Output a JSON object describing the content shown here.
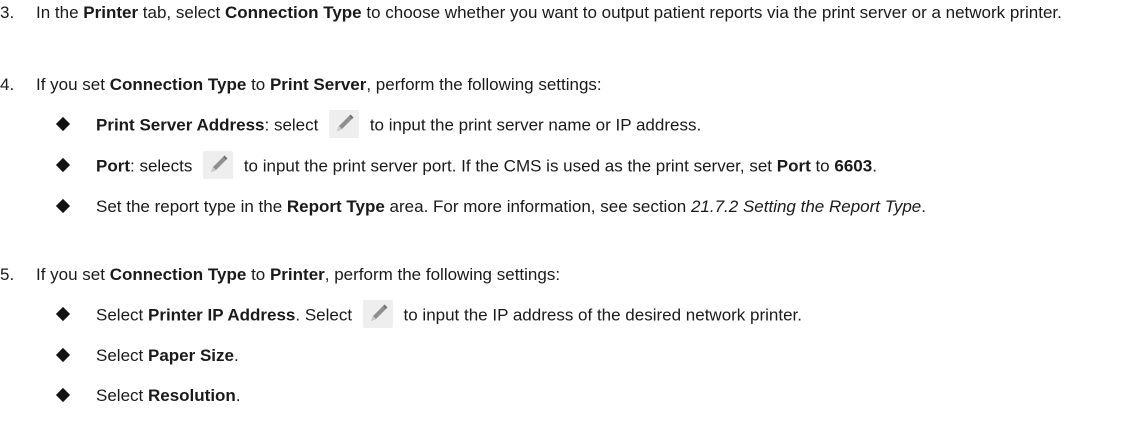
{
  "steps": [
    {
      "num": "3.",
      "parts": [
        {
          "t": "In the "
        },
        {
          "t": "Printer",
          "b": true
        },
        {
          "t": " tab, select "
        },
        {
          "t": "Connection Type",
          "b": true
        },
        {
          "t": " to choose whether you want to output patient reports via the print server or a network printer."
        }
      ]
    },
    {
      "num": "4.",
      "parts": [
        {
          "t": "If you set "
        },
        {
          "t": "Connection Type",
          "b": true
        },
        {
          "t": " to "
        },
        {
          "t": "Print Server",
          "b": true
        },
        {
          "t": ", perform the following settings:"
        }
      ],
      "bullets": [
        [
          {
            "t": "Print Server Address",
            "b": true
          },
          {
            "t": ": select "
          },
          {
            "icon": "pencil-edit-icon"
          },
          {
            "t": " to input the print server name or IP address."
          }
        ],
        [
          {
            "t": "Port",
            "b": true
          },
          {
            "t": ": selects "
          },
          {
            "icon": "pencil-edit-icon"
          },
          {
            "t": " to input the print server port. If the CMS is used as the print server, set "
          },
          {
            "t": "Port",
            "b": true
          },
          {
            "t": " to "
          },
          {
            "t": "6603",
            "b": true
          },
          {
            "t": "."
          }
        ],
        [
          {
            "t": "Set the report type in the "
          },
          {
            "t": "Report Type",
            "b": true
          },
          {
            "t": " area. For more information, see section "
          },
          {
            "t": "21.7.2 Setting the Report Type",
            "i": true
          },
          {
            "t": "."
          }
        ]
      ]
    },
    {
      "num": "5.",
      "parts": [
        {
          "t": "If you set "
        },
        {
          "t": "Connection Type",
          "b": true
        },
        {
          "t": " to "
        },
        {
          "t": "Printer",
          "b": true
        },
        {
          "t": ", perform the following settings:"
        }
      ],
      "bullets": [
        [
          {
            "t": "Select "
          },
          {
            "t": "Printer IP Address",
            "b": true
          },
          {
            "t": ". Select "
          },
          {
            "icon": "pencil-edit-icon"
          },
          {
            "t": " to input the IP address of the desired network printer."
          }
        ],
        [
          {
            "t": "Select "
          },
          {
            "t": "Paper Size",
            "b": true
          },
          {
            "t": "."
          }
        ],
        [
          {
            "t": "Select "
          },
          {
            "t": "Resolution",
            "b": true
          },
          {
            "t": "."
          }
        ]
      ]
    }
  ]
}
